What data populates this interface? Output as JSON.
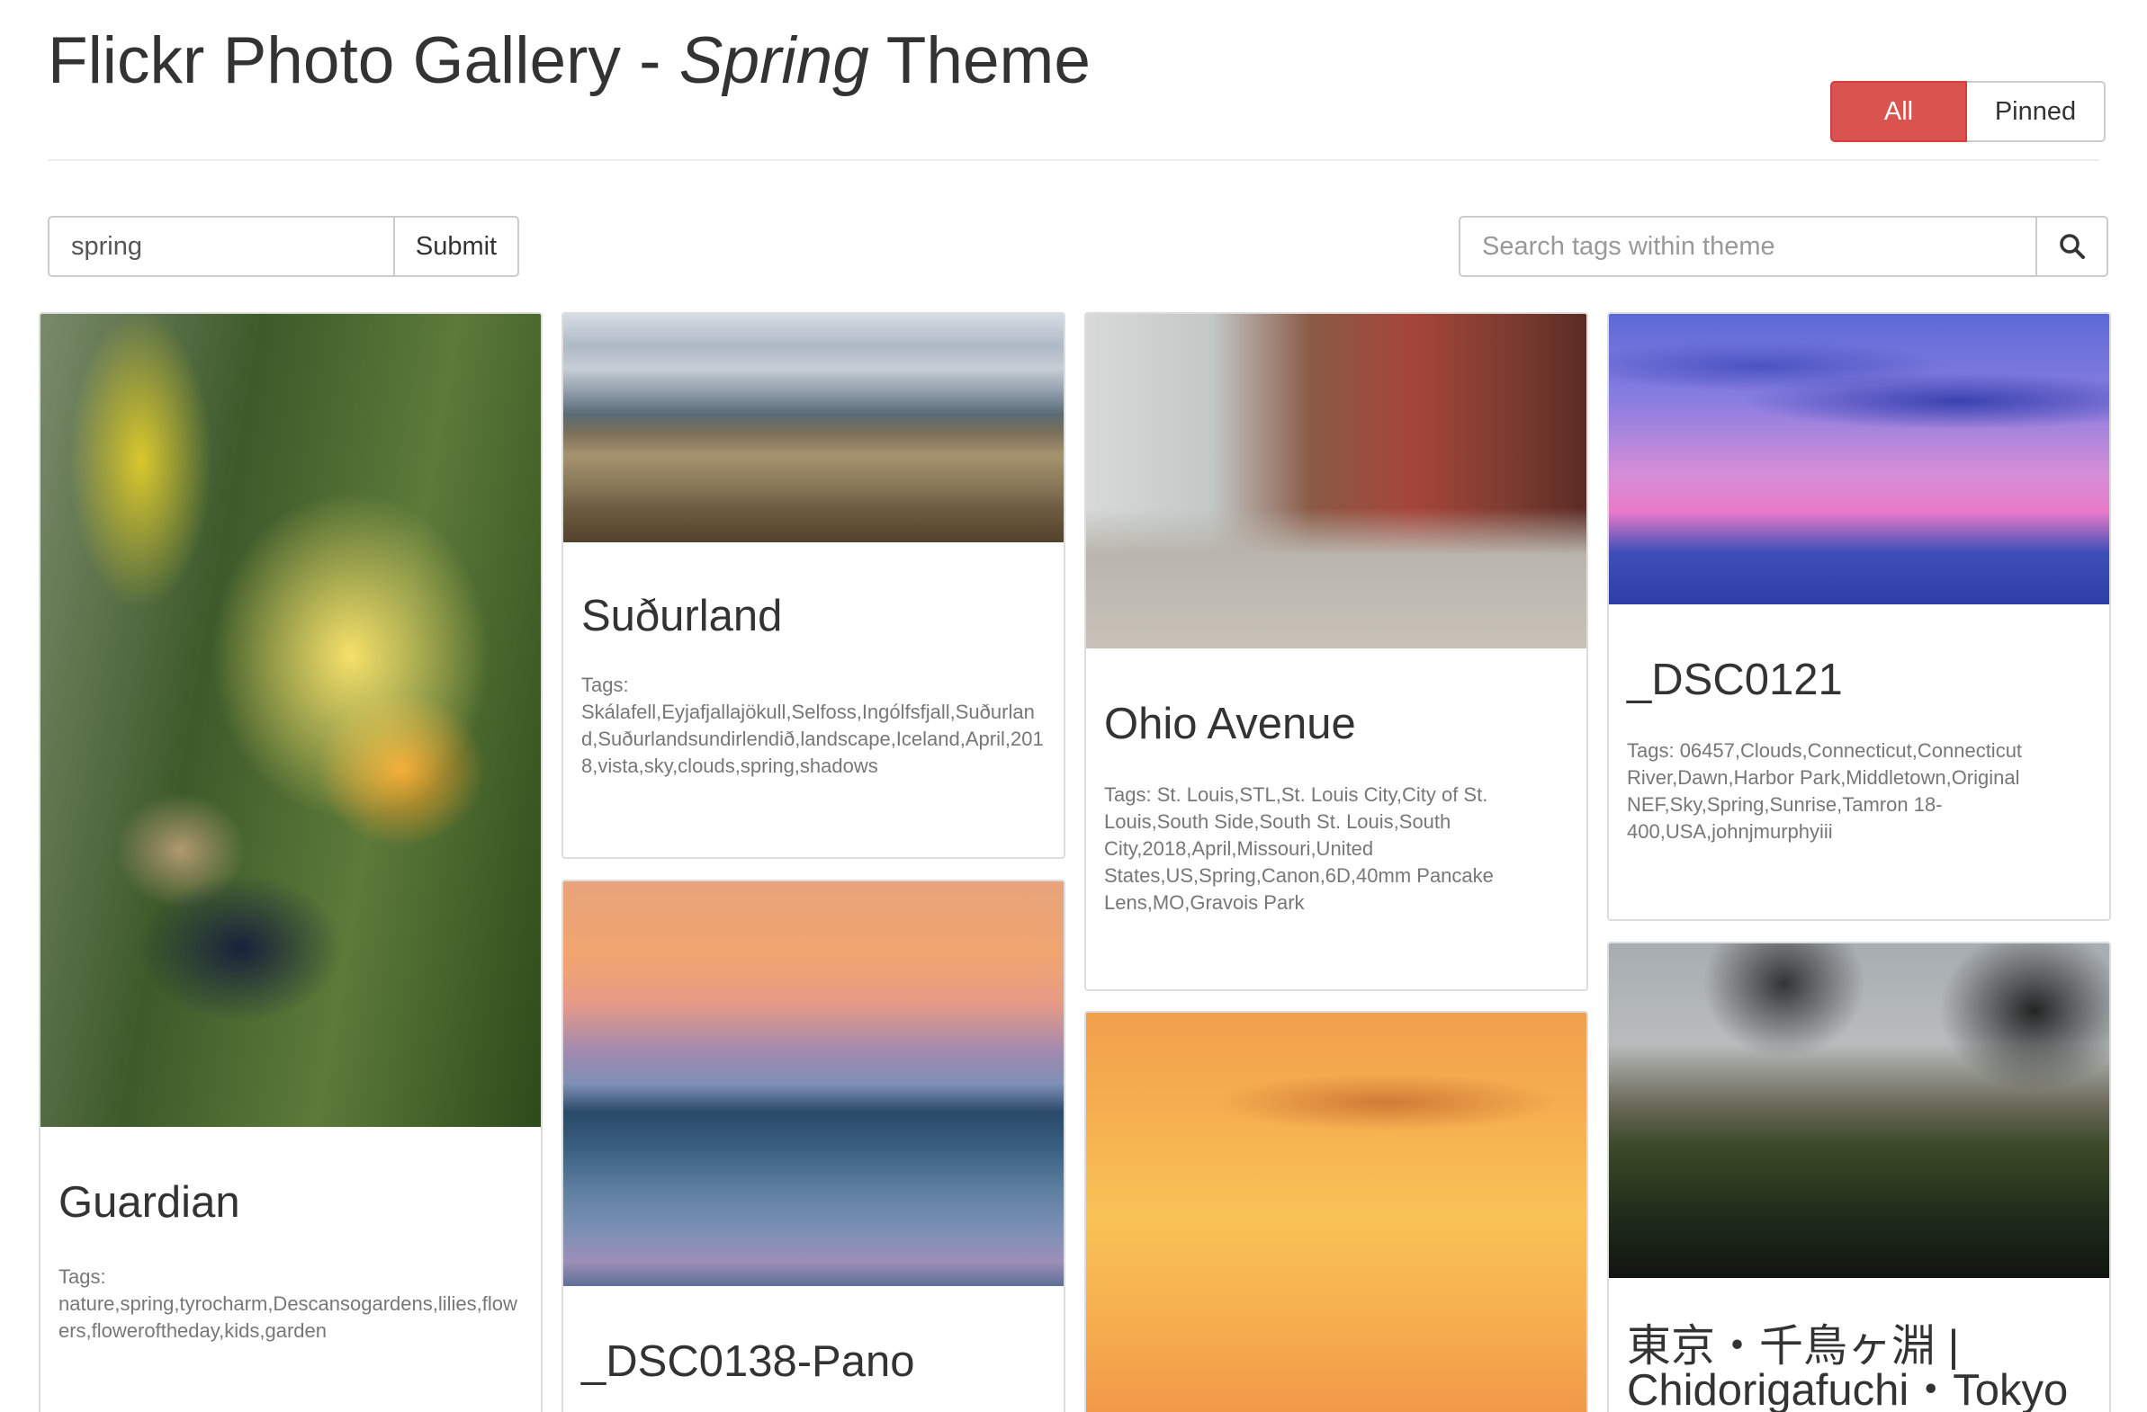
{
  "header": {
    "title_prefix": "Flickr Photo Gallery - ",
    "title_theme": "Spring",
    "title_suffix": " Theme"
  },
  "filter": {
    "all_label": "All",
    "pinned_label": "Pinned",
    "active": "All",
    "accent_color": "#d9534f"
  },
  "search": {
    "value": "spring",
    "submit_label": "Submit"
  },
  "tag_search": {
    "placeholder": "Search tags within theme",
    "icon": "search-icon"
  },
  "cards": [
    {
      "title": "Guardian",
      "tags": "Tags: nature,spring,tyrocharm,Descansogardens,lilies,flowers,floweroftheday,kids,garden"
    },
    {
      "title": "Suðurland",
      "tags": "Tags: Skálafell,Eyjafjallajökull,Selfoss,Ingólfsfjall,Suðurland,Suðurlandsundirlendið,landscape,Iceland,April,2018,vista,sky,clouds,spring,shadows"
    },
    {
      "title": "_DSC0138-Pano",
      "tags": ""
    },
    {
      "title": "Ohio Avenue",
      "tags": "Tags: St. Louis,STL,St. Louis City,City of St. Louis,South Side,South St. Louis,South City,2018,April,Missouri,United States,US,Spring,Canon,6D,40mm Pancake Lens,MO,Gravois Park"
    },
    {
      "title": "",
      "tags": ""
    },
    {
      "title": "_DSC0121",
      "tags": "Tags: 06457,Clouds,Connecticut,Connecticut River,Dawn,Harbor Park,Middletown,Original NEF,Sky,Spring,Sunrise,Tamron 18-400,USA,johnjmurphyiii"
    },
    {
      "title": "東京・千鳥ヶ淵 | Chidorigafuchi・Tokyo",
      "tags": ""
    }
  ]
}
